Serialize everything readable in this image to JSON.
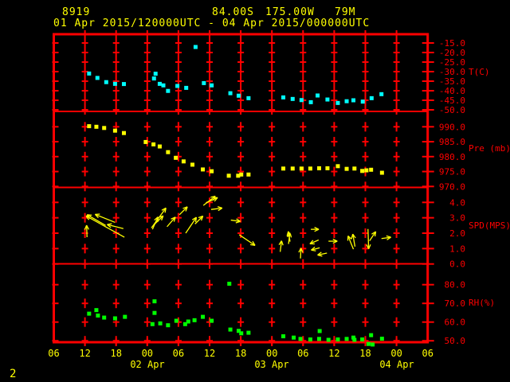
{
  "header": {
    "station_id": "8919",
    "latitude": "84.00S",
    "longitude": "175.00W",
    "elevation": "79M",
    "time_range": "01 Apr 2015/120000UTC - 04 Apr 2015/000000UTC"
  },
  "page_number": "2",
  "colors": {
    "background": "#000000",
    "frame": "#ff0000",
    "axis_text": "#ff0000",
    "time_text": "#ffff00",
    "temperature": "#00ffff",
    "pressure": "#ffff00",
    "wind": "#ffff00",
    "rh": "#00ff00"
  },
  "x_axis": {
    "start_label_utc": "06",
    "hours_span": 72,
    "hour_labels": [
      "06",
      "12",
      "18",
      "00",
      "06",
      "12",
      "18",
      "00",
      "06",
      "12",
      "18",
      "00",
      "06"
    ],
    "date_labels": [
      {
        "label": "02 Apr",
        "hour": 18
      },
      {
        "label": "03 Apr",
        "hour": 42
      },
      {
        "label": "04 Apr",
        "hour": 66
      }
    ]
  },
  "chart_data": [
    {
      "type": "scatter",
      "name": "temperature",
      "unit_label": "T(C)",
      "color": "#00ffff",
      "yticks": [
        -15.0,
        -20.0,
        -25.0,
        -30.0,
        -35.0,
        -40.0,
        -45.0,
        -50.0
      ],
      "x_unit": "hours since 01 Apr 2015 0600 UTC",
      "points": [
        [
          6.8,
          -31.0
        ],
        [
          8.4,
          -33.3
        ],
        [
          10.1,
          -35.5
        ],
        [
          11.8,
          -36.4
        ],
        [
          13.5,
          -36.5
        ],
        [
          19.3,
          -33.6
        ],
        [
          19.6,
          -31.1
        ],
        [
          20.4,
          -36.4
        ],
        [
          21.1,
          -37.2
        ],
        [
          22.0,
          -40.1
        ],
        [
          23.8,
          -37.5
        ],
        [
          25.5,
          -38.5
        ],
        [
          27.3,
          -17.1
        ],
        [
          28.9,
          -36.0
        ],
        [
          30.4,
          -37.2
        ],
        [
          34.0,
          -41.3
        ],
        [
          35.6,
          -42.6
        ],
        [
          37.5,
          -43.9
        ],
        [
          44.2,
          -43.5
        ],
        [
          46.0,
          -44.3
        ],
        [
          47.7,
          -44.9
        ],
        [
          49.5,
          -46.0
        ],
        [
          50.8,
          -42.5
        ],
        [
          52.7,
          -44.6
        ],
        [
          54.7,
          -46.4
        ],
        [
          56.4,
          -45.5
        ],
        [
          57.7,
          -45.0
        ],
        [
          59.5,
          -45.7
        ],
        [
          61.2,
          -43.9
        ],
        [
          63.1,
          -41.8
        ]
      ]
    },
    {
      "type": "scatter",
      "name": "pressure",
      "unit_label": "Pre (mb)",
      "color": "#ffff00",
      "yticks": [
        990.0,
        985.0,
        980.0,
        975.0,
        970.0
      ],
      "x_unit": "hours since 01 Apr 2015 0600 UTC",
      "points": [
        [
          6.8,
          990.2
        ],
        [
          8.2,
          990.0
        ],
        [
          9.7,
          989.6
        ],
        [
          11.8,
          988.7
        ],
        [
          13.5,
          987.9
        ],
        [
          17.7,
          984.9
        ],
        [
          19.2,
          984.1
        ],
        [
          20.4,
          983.4
        ],
        [
          22.0,
          981.5
        ],
        [
          23.5,
          979.6
        ],
        [
          25.0,
          978.4
        ],
        [
          26.7,
          977.3
        ],
        [
          28.7,
          975.7
        ],
        [
          30.4,
          975.1
        ],
        [
          33.7,
          973.6
        ],
        [
          35.5,
          973.6
        ],
        [
          36.1,
          974.0
        ],
        [
          37.5,
          974.0
        ],
        [
          44.2,
          976.0
        ],
        [
          46.0,
          976.0
        ],
        [
          47.7,
          976.0
        ],
        [
          49.4,
          976.0
        ],
        [
          51.1,
          976.1
        ],
        [
          52.7,
          976.1
        ],
        [
          54.7,
          976.8
        ],
        [
          56.4,
          975.9
        ],
        [
          57.9,
          976.0
        ],
        [
          59.4,
          975.2
        ],
        [
          60.2,
          975.4
        ],
        [
          61.1,
          975.6
        ],
        [
          63.2,
          974.6
        ]
      ]
    },
    {
      "type": "vector",
      "name": "wind",
      "unit_label": "SPD(MPS)",
      "color": "#ffff00",
      "yticks": [
        4.0,
        3.0,
        2.0,
        1.0,
        0.0
      ],
      "x_unit": "hours since 01 Apr 2015 0600 UTC",
      "vector_format": [
        "hour",
        "speed_mps",
        "direction_deg_ccw_from_east",
        "arrow_len_px"
      ],
      "vectors": [
        [
          6.4,
          1.74,
          92,
          15
        ],
        [
          10.0,
          2.5,
          150,
          27
        ],
        [
          11.8,
          2.7,
          158,
          27
        ],
        [
          13.4,
          2.3,
          166,
          21
        ],
        [
          13.6,
          1.74,
          151,
          55
        ],
        [
          18.8,
          2.34,
          54,
          31
        ],
        [
          19.0,
          2.25,
          66,
          17
        ],
        [
          19.3,
          2.55,
          44,
          16
        ],
        [
          21.8,
          2.42,
          49,
          16
        ],
        [
          24.2,
          3.2,
          45,
          14
        ],
        [
          25.4,
          2.0,
          56,
          24
        ],
        [
          27.2,
          2.6,
          45,
          14
        ],
        [
          28.8,
          3.8,
          38,
          19
        ],
        [
          29.3,
          3.97,
          24,
          16
        ],
        [
          30.3,
          3.54,
          7,
          14
        ],
        [
          34.1,
          2.85,
          -8,
          12
        ],
        [
          35.7,
          1.9,
          -34,
          24
        ],
        [
          43.6,
          0.79,
          83,
          14
        ],
        [
          45.2,
          1.3,
          83,
          14
        ],
        [
          45.5,
          1.45,
          100,
          13
        ],
        [
          47.5,
          0.36,
          87,
          13
        ],
        [
          49.5,
          2.25,
          0,
          10
        ],
        [
          51.0,
          1.56,
          204,
          12
        ],
        [
          51.2,
          1.05,
          195,
          11
        ],
        [
          52.9,
          1.48,
          0,
          11
        ],
        [
          52.6,
          0.71,
          192,
          12
        ],
        [
          57.7,
          0.96,
          112,
          18
        ],
        [
          58.0,
          1.13,
          100,
          16
        ],
        [
          60.5,
          2.27,
          -88,
          25
        ],
        [
          60.8,
          1.5,
          56,
          14
        ],
        [
          63.1,
          1.65,
          8,
          12
        ]
      ]
    },
    {
      "type": "scatter",
      "name": "relative_humidity",
      "unit_label": "RH(%)",
      "color": "#00ff00",
      "yticks": [
        80.0,
        70.0,
        60.0,
        50.0
      ],
      "x_unit": "hours since 01 Apr 2015 0600 UTC",
      "points": [
        [
          6.8,
          64.5
        ],
        [
          8.2,
          66.4
        ],
        [
          8.5,
          63.5
        ],
        [
          9.7,
          62.4
        ],
        [
          11.8,
          62.0
        ],
        [
          13.7,
          62.8
        ],
        [
          19.0,
          58.9
        ],
        [
          19.4,
          71.1
        ],
        [
          19.4,
          64.9
        ],
        [
          20.5,
          59.3
        ],
        [
          22.0,
          58.3
        ],
        [
          23.6,
          60.7
        ],
        [
          25.3,
          58.9
        ],
        [
          25.9,
          60.3
        ],
        [
          27.1,
          61.0
        ],
        [
          28.7,
          62.8
        ],
        [
          30.4,
          60.7
        ],
        [
          33.8,
          80.5
        ],
        [
          34.0,
          56.0
        ],
        [
          35.6,
          55.3
        ],
        [
          36.1,
          54.0
        ],
        [
          37.5,
          54.3
        ],
        [
          44.2,
          52.4
        ],
        [
          46.2,
          51.7
        ],
        [
          47.5,
          51.0
        ],
        [
          49.4,
          50.7
        ],
        [
          51.1,
          51.0
        ],
        [
          51.2,
          55.2
        ],
        [
          52.9,
          50.5
        ],
        [
          54.7,
          50.7
        ],
        [
          56.4,
          51.0
        ],
        [
          57.7,
          51.7
        ],
        [
          57.9,
          50.5
        ],
        [
          59.4,
          50.7
        ],
        [
          60.6,
          48.3
        ],
        [
          61.1,
          53.0
        ],
        [
          61.4,
          48.0
        ],
        [
          63.2,
          51.1
        ]
      ]
    }
  ]
}
